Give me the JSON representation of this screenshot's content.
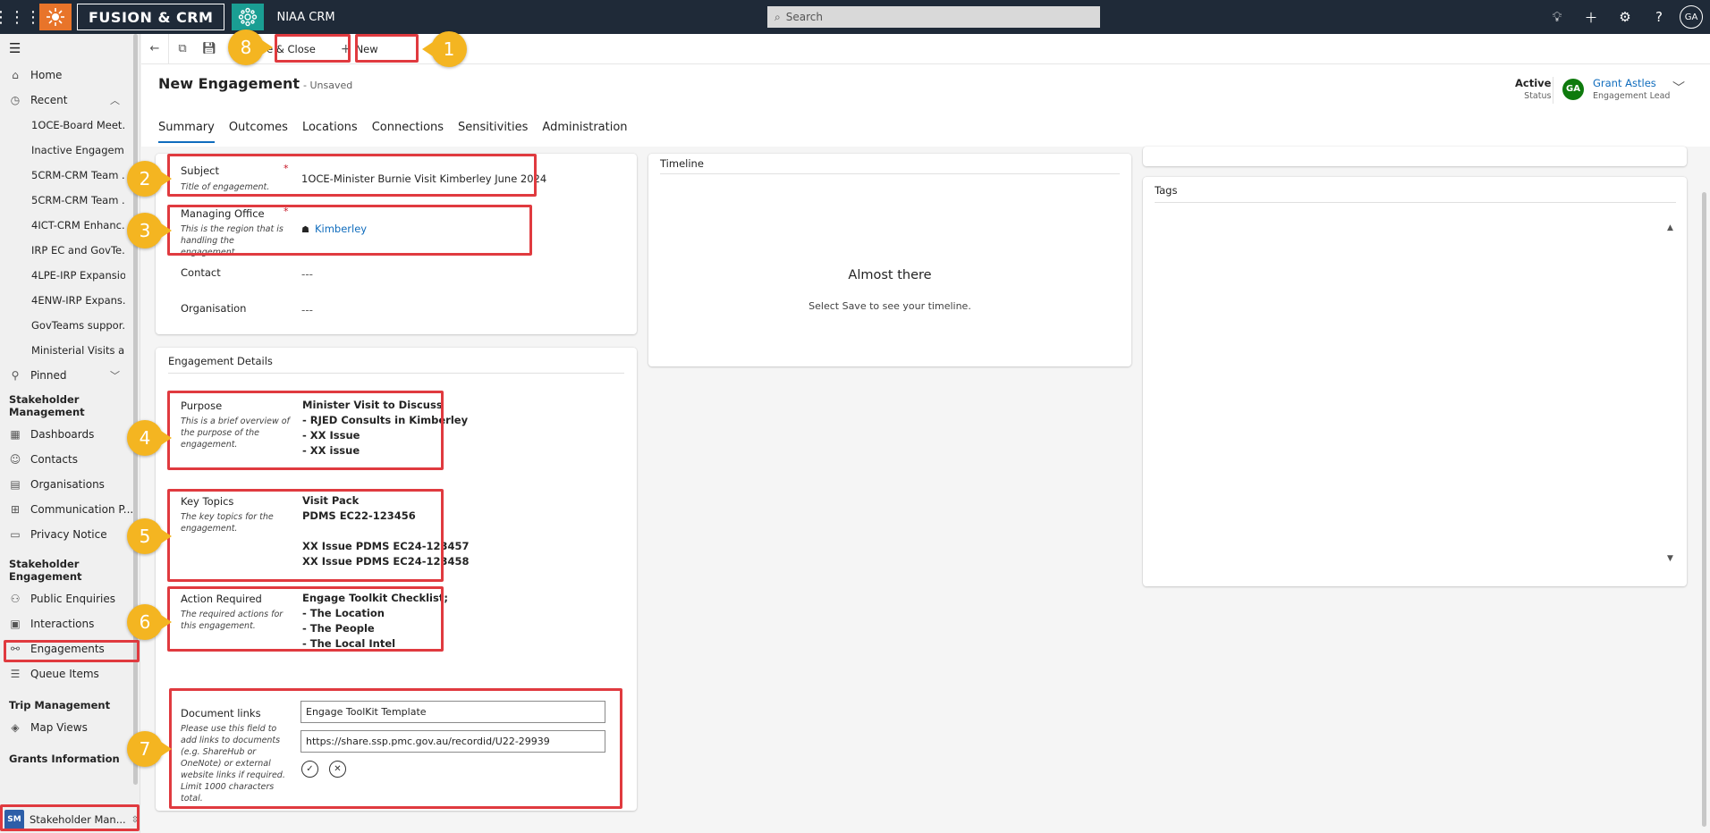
{
  "topbar": {
    "brand": "FUSION & CRM",
    "app_name": "NIAA CRM",
    "search_placeholder": "Search",
    "user_initials": "GA"
  },
  "sidebar": {
    "items": [
      {
        "label": "Home",
        "icon": "home-icon"
      },
      {
        "label": "Recent",
        "icon": "clock-icon"
      }
    ],
    "recent": [
      "1OCE-Board Meet...",
      "Inactive Engagem...",
      "5CRM-CRM Team ...",
      "5CRM-CRM Team ...",
      "4ICT-CRM Enhanc...",
      "IRP EC and GovTe...",
      "4LPE-IRP Expansio...",
      "4ENW-IRP Expans...",
      "GovTeams suppor...",
      "Ministerial Visits a..."
    ],
    "pinned": "Pinned",
    "group1": "Stakeholder Management",
    "group1_items": [
      "Dashboards",
      "Contacts",
      "Organisations",
      "Communication P...",
      "Privacy Notice"
    ],
    "group2": "Stakeholder Engagement",
    "group2_items": [
      "Public Enquiries",
      "Interactions",
      "Engagements",
      "Queue Items"
    ],
    "group3": "Trip Management",
    "group3_items": [
      "Map Views"
    ],
    "group4": "Grants Information",
    "area_badge": "SM",
    "area_label": "Stakeholder Man..."
  },
  "cmdbar": {
    "save_close": "Save & Close",
    "new": "New"
  },
  "header": {
    "title": "New Engagement",
    "unsaved": "- Unsaved",
    "status_value": "Active",
    "status_label": "Status",
    "owner_initials": "GA",
    "owner_name": "Grant Astles",
    "owner_role": "Engagement Lead"
  },
  "tabs": [
    "Summary",
    "Outcomes",
    "Locations",
    "Connections",
    "Sensitivities",
    "Administration"
  ],
  "general": {
    "subject_label": "Subject",
    "subject_desc": "Title of engagement.",
    "subject_value": "1OCE-Minister Burnie Visit Kimberley June 2024",
    "office_label": "Managing Office",
    "office_desc": "This is the region that is handling the engagement.",
    "office_value": "Kimberley",
    "contact_label": "Contact",
    "contact_value": "---",
    "org_label": "Organisation",
    "org_value": "---"
  },
  "details": {
    "title": "Engagement Details",
    "purpose_label": "Purpose",
    "purpose_desc": "This is a brief overview of the purpose of the engagement.",
    "purpose_lines": [
      "Minister Visit to Discuss",
      "- RJED Consults in Kimberley",
      "- XX Issue",
      "- XX issue"
    ],
    "topics_label": "Key Topics",
    "topics_desc": "The key topics for the engagement.",
    "topics_lines": [
      "Visit Pack",
      "PDMS EC22-123456",
      "",
      "XX Issue PDMS EC24-123457",
      "XX Issue PDMS EC24-123458"
    ],
    "action_label": "Action Required",
    "action_desc": "The required actions for this engagement.",
    "action_lines": [
      "Engage Toolkit Checklist;",
      "- The Location",
      "- The People",
      "- The Local Intel"
    ],
    "doc_label": "Document links",
    "doc_desc": "Please use this field to add links to documents (e.g. ShareHub or OneNote) or external website links if required. Limit 1000 characters total.",
    "doc_input1": "Engage ToolKit Template",
    "doc_input2": "https://share.ssp.pmc.gov.au/recordid/U22-29939"
  },
  "timeline": {
    "title": "Timeline",
    "heading": "Almost there",
    "text": "Select Save to see your timeline."
  },
  "tags": {
    "title": "Tags"
  },
  "callouts": [
    "1",
    "2",
    "3",
    "4",
    "5",
    "6",
    "7",
    "8"
  ],
  "colors": {
    "topbar": "#1f2a38",
    "accent": "#0f6cbd",
    "annotation_red": "#e03a3f",
    "callout_yellow": "#f4b521"
  }
}
